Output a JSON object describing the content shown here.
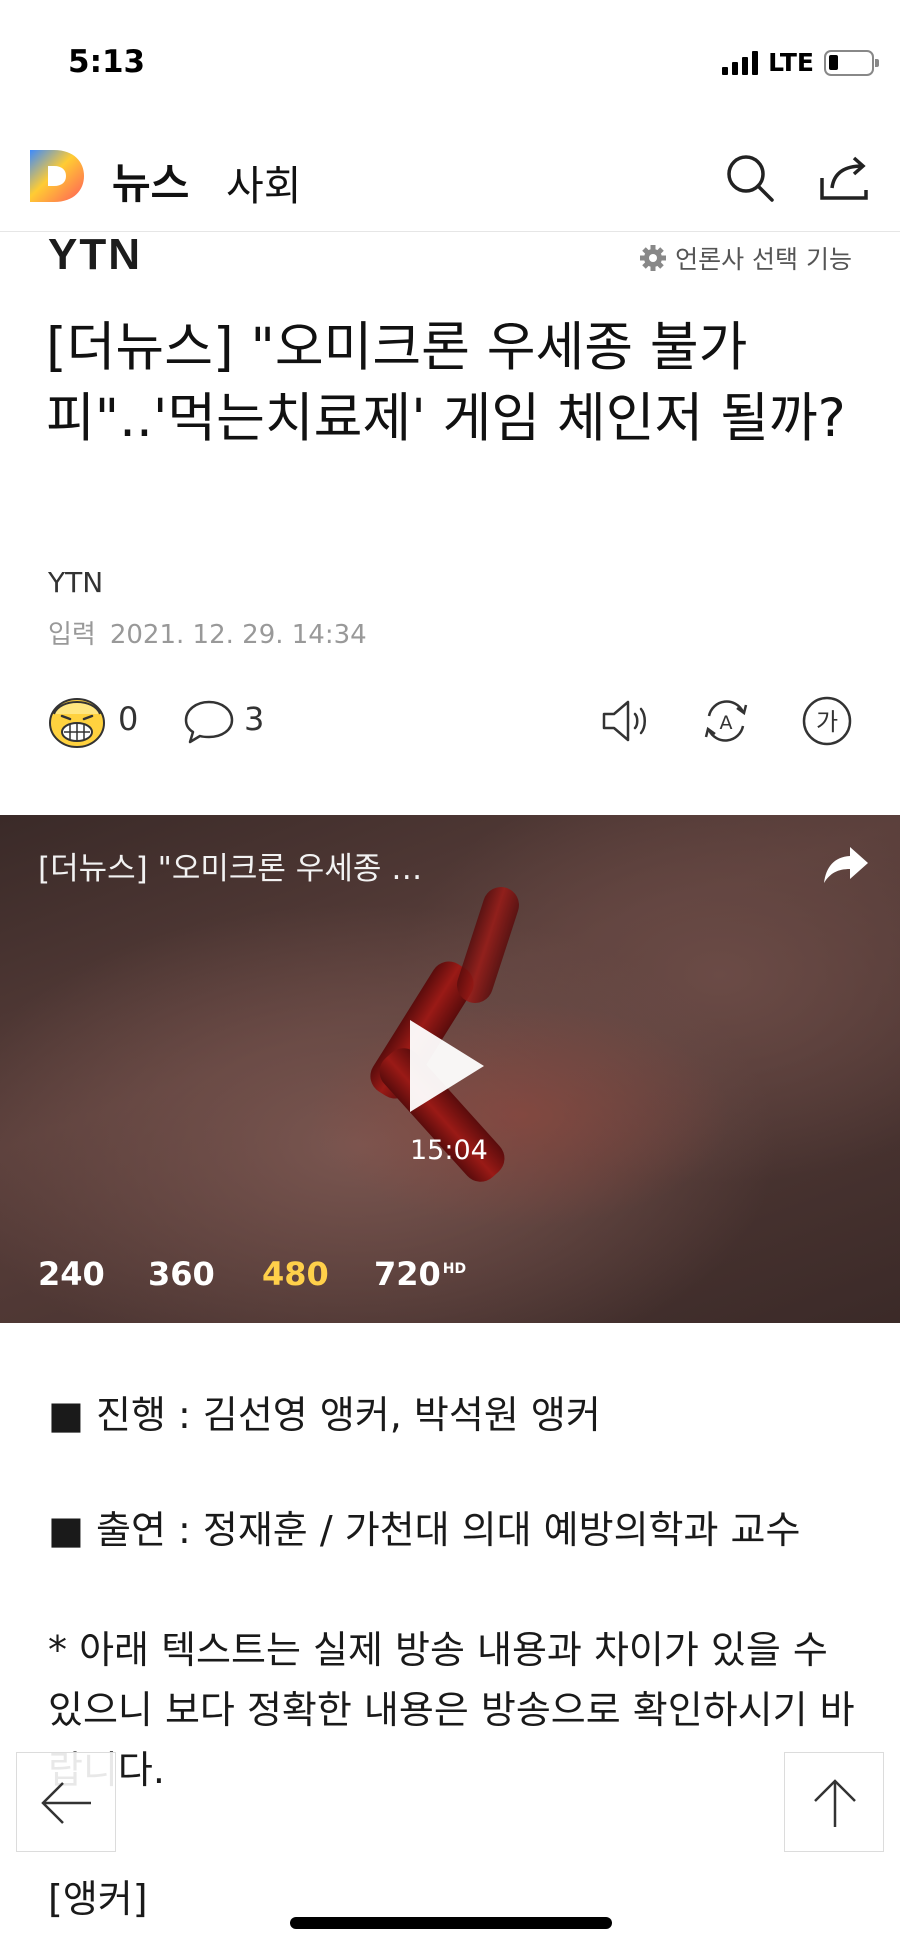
{
  "status_bar": {
    "time": "5:13",
    "network": "LTE"
  },
  "header": {
    "title": "뉴스",
    "section": "사회"
  },
  "article": {
    "press": "YTN",
    "press_select_label": "언론사 선택 기능",
    "headline": "[더뉴스] \"오미크론 우세종 불가피\"..'먹는치료제' 게임 체인저 될까?",
    "byline": "YTN",
    "input_label": "입력",
    "input_datetime": "2021. 12. 29. 14:34",
    "reaction_count": "0",
    "comment_count": "3"
  },
  "video": {
    "title": "[더뉴스] \"오미크론 우세종 …",
    "duration": "15:04",
    "qualities": [
      "240",
      "360",
      "480",
      "720"
    ],
    "selected_quality": "480",
    "hd_badge": "HD"
  },
  "body": {
    "host_line": "■ 진행 : 김선영 앵커, 박석원 앵커",
    "guest_line": "■ 출연 : 정재훈 / 가천대 의대 예방의학과 교수",
    "notice": "* 아래 텍스트는 실제 방송 내용과 차이가 있을 수 있으니 보다 정확한 내용은 방송으로 확인하시기 바랍니다.",
    "speaker": "[앵커]"
  },
  "colors": {
    "selected_quality": "#ffd04a",
    "logo_gradient": [
      "#3d8bfd",
      "#ffcc33",
      "#ff5a5a"
    ]
  }
}
